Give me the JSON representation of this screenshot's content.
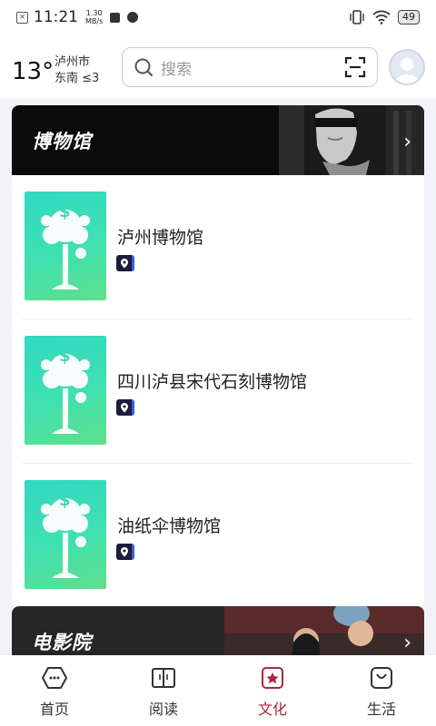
{
  "status_bar": {
    "time": "11:21",
    "speed_value": "1.30",
    "speed_unit": "MB/s",
    "battery": "49"
  },
  "header": {
    "temperature": "13°",
    "city": "泸州市",
    "wind": "东南 ≤3",
    "search_placeholder": "搜索"
  },
  "museum_section": {
    "title": "博物馆",
    "items": [
      {
        "name": "泸州博物馆"
      },
      {
        "name": "四川泸县宋代石刻博物馆"
      },
      {
        "name": "油纸伞博物馆"
      }
    ]
  },
  "cinema_section": {
    "title": "电影院"
  },
  "tabs": [
    {
      "label": "首页",
      "icon": "home-icon"
    },
    {
      "label": "阅读",
      "icon": "book-icon"
    },
    {
      "label": "文化",
      "icon": "culture-star-icon",
      "active": true
    },
    {
      "label": "生活",
      "icon": "life-bag-icon"
    }
  ],
  "colors": {
    "accent": "#b0233c",
    "thumb_green": "#40e0b0",
    "banner_bg": "#0b0b0b"
  }
}
